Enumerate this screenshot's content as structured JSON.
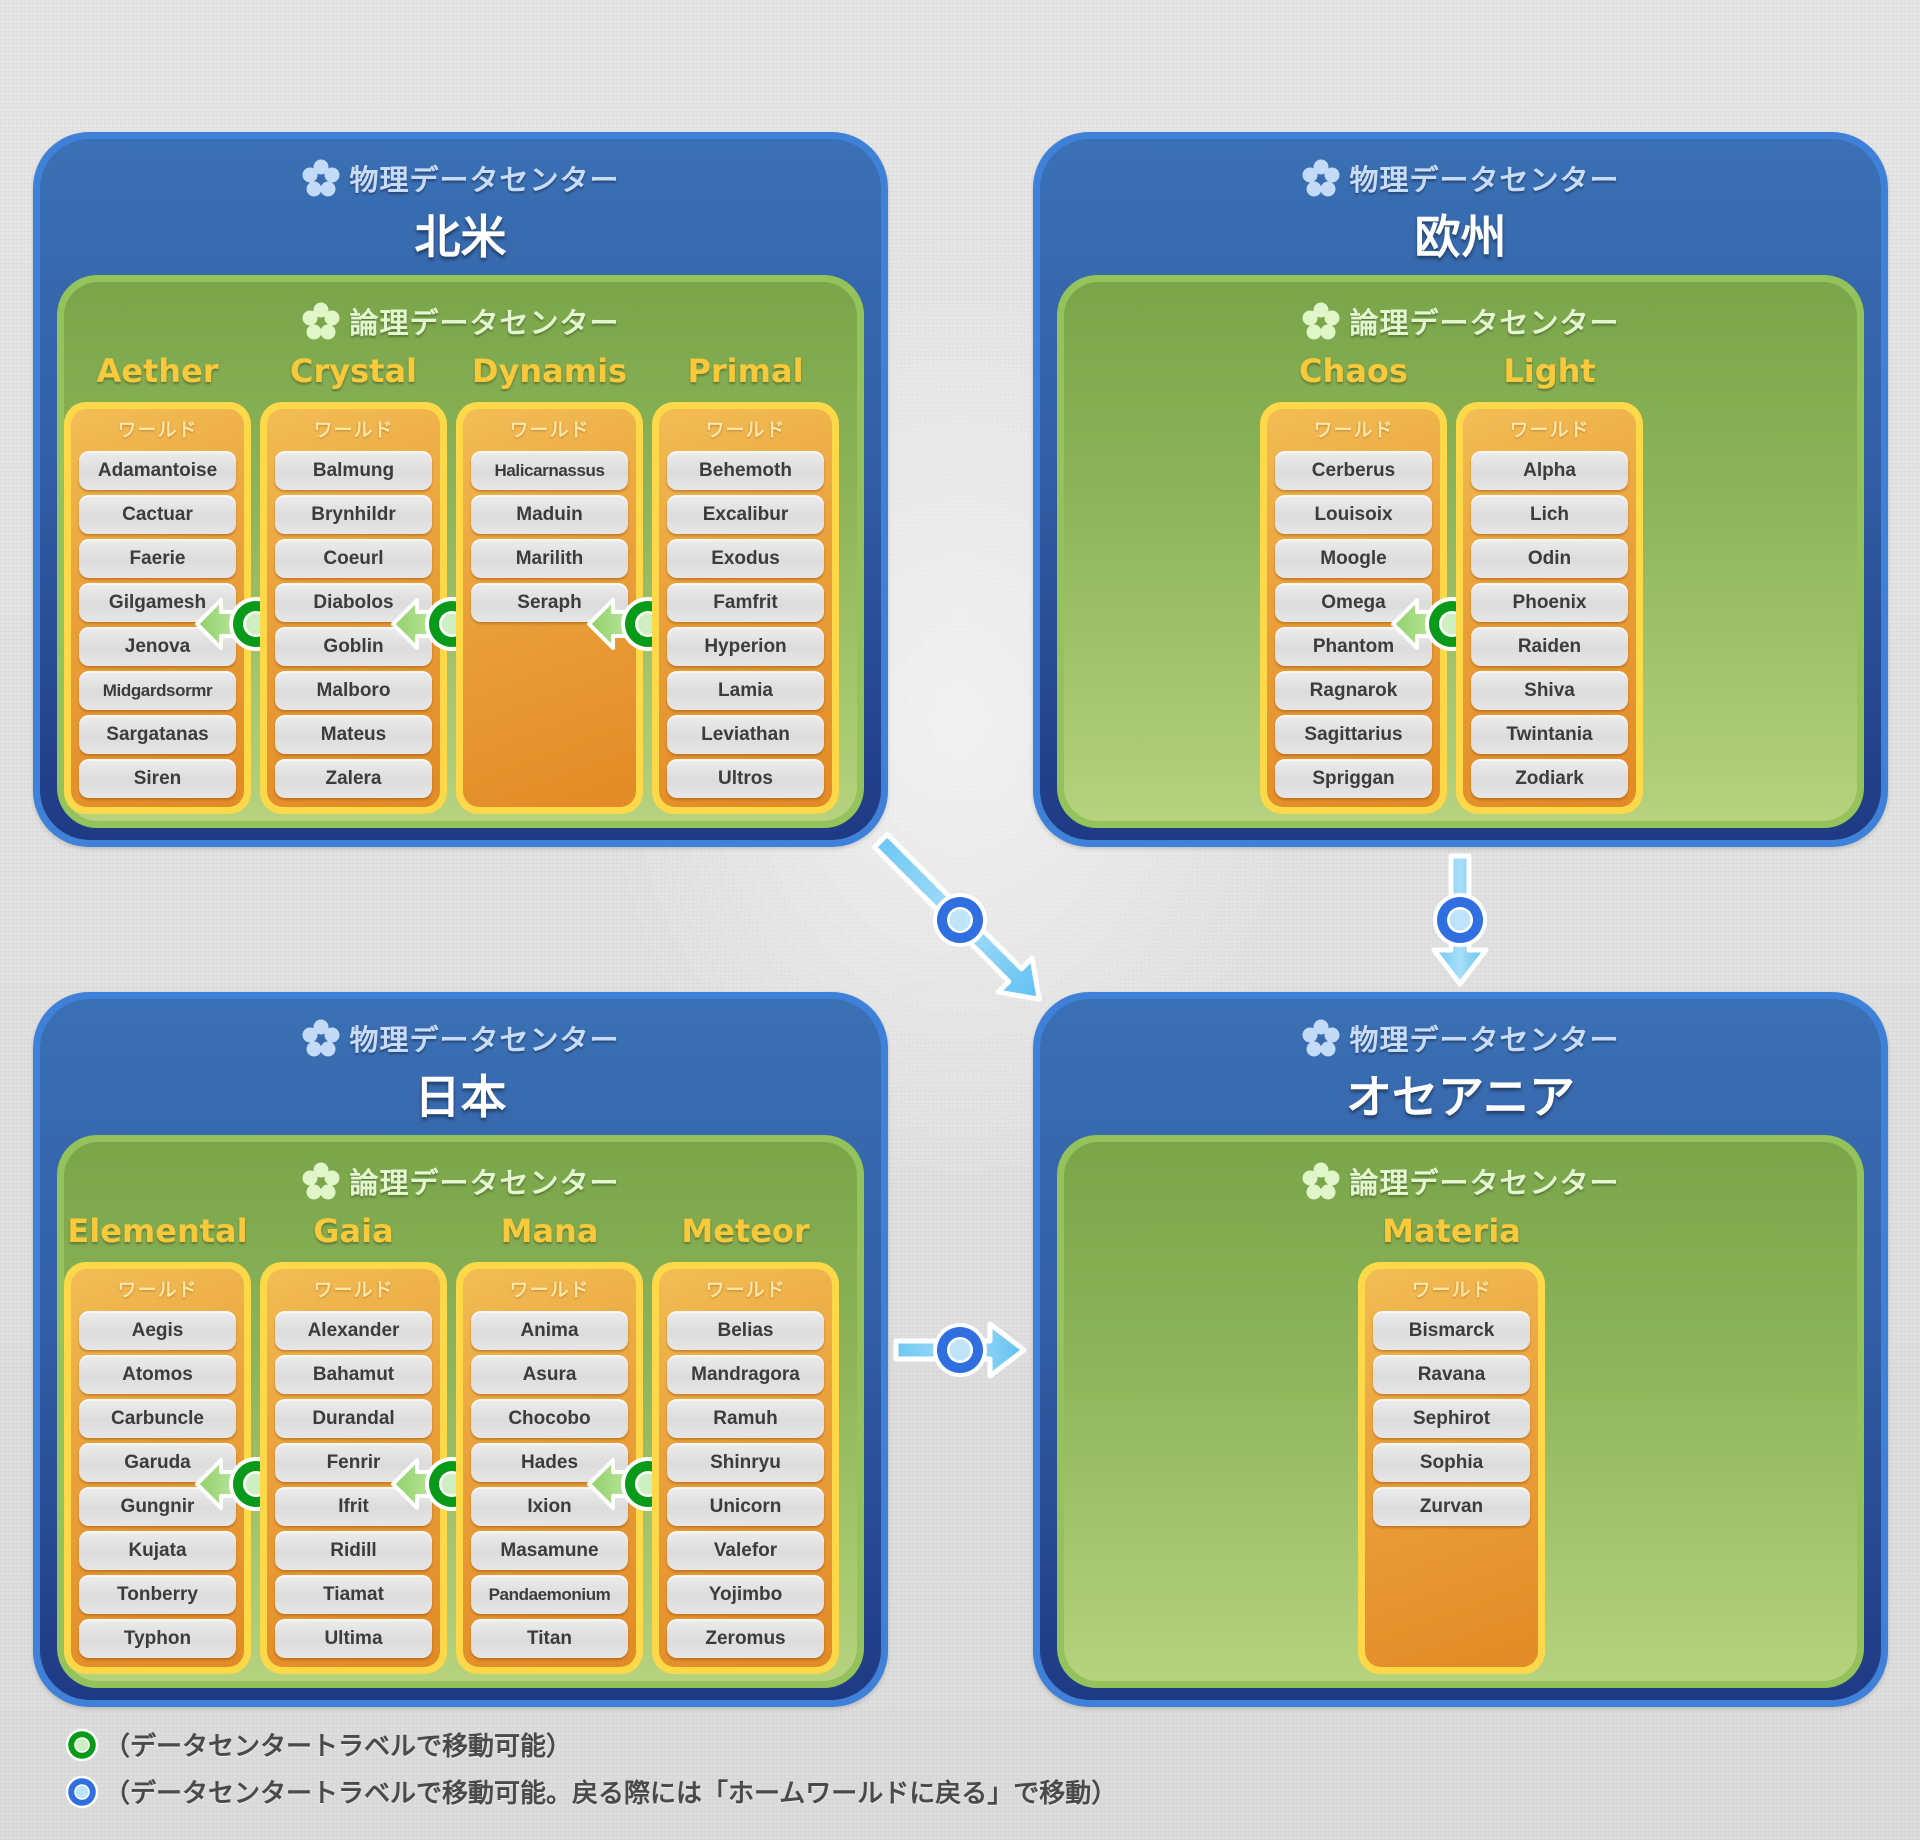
{
  "labels": {
    "physical_dc": "物理データセンター",
    "logical_dc": "論理データセンター",
    "world_header": "ワールド"
  },
  "colors": {
    "physical_border": "#3f80d8",
    "physical_fill": "#335fa6",
    "logical_border": "#93c35a",
    "logical_fill": "#8db45a",
    "dc_name": "#f8c93b",
    "column_border": "#fdd94a",
    "column_fill": "#eba23c",
    "green_marker": "#0a9a1a",
    "blue_marker": "#2f6fe0"
  },
  "regions": [
    {
      "id": "na",
      "title": "北米",
      "data_centers": [
        {
          "name": "Aether",
          "worlds": [
            "Adamantoise",
            "Cactuar",
            "Faerie",
            "Gilgamesh",
            "Jenova",
            "Midgardsormr",
            "Sargatanas",
            "Siren"
          ]
        },
        {
          "name": "Crystal",
          "worlds": [
            "Balmung",
            "Brynhildr",
            "Coeurl",
            "Diabolos",
            "Goblin",
            "Malboro",
            "Mateus",
            "Zalera"
          ]
        },
        {
          "name": "Dynamis",
          "worlds": [
            "Halicarnassus",
            "Maduin",
            "Marilith",
            "Seraph"
          ]
        },
        {
          "name": "Primal",
          "worlds": [
            "Behemoth",
            "Excalibur",
            "Exodus",
            "Famfrit",
            "Hyperion",
            "Lamia",
            "Leviathan",
            "Ultros"
          ]
        }
      ]
    },
    {
      "id": "eu",
      "title": "欧州",
      "data_centers": [
        {
          "name": "Chaos",
          "worlds": [
            "Cerberus",
            "Louisoix",
            "Moogle",
            "Omega",
            "Phantom",
            "Ragnarok",
            "Sagittarius",
            "Spriggan"
          ]
        },
        {
          "name": "Light",
          "worlds": [
            "Alpha",
            "Lich",
            "Odin",
            "Phoenix",
            "Raiden",
            "Shiva",
            "Twintania",
            "Zodiark"
          ]
        }
      ]
    },
    {
      "id": "jp",
      "title": "日本",
      "data_centers": [
        {
          "name": "Elemental",
          "worlds": [
            "Aegis",
            "Atomos",
            "Carbuncle",
            "Garuda",
            "Gungnir",
            "Kujata",
            "Tonberry",
            "Typhon"
          ]
        },
        {
          "name": "Gaia",
          "worlds": [
            "Alexander",
            "Bahamut",
            "Durandal",
            "Fenrir",
            "Ifrit",
            "Ridill",
            "Tiamat",
            "Ultima"
          ]
        },
        {
          "name": "Mana",
          "worlds": [
            "Anima",
            "Asura",
            "Chocobo",
            "Hades",
            "Ixion",
            "Masamune",
            "Pandaemonium",
            "Titan"
          ]
        },
        {
          "name": "Meteor",
          "worlds": [
            "Belias",
            "Mandragora",
            "Ramuh",
            "Shinryu",
            "Unicorn",
            "Valefor",
            "Yojimbo",
            "Zeromus"
          ]
        }
      ]
    },
    {
      "id": "oc",
      "title": "オセアニア",
      "data_centers": [
        {
          "name": "Materia",
          "worlds": [
            "Bismarck",
            "Ravana",
            "Sephirot",
            "Sophia",
            "Zurvan"
          ]
        }
      ]
    }
  ],
  "connections": {
    "green_two_way": [
      "Aether-Crystal",
      "Crystal-Dynamis",
      "Dynamis-Primal",
      "Chaos-Light",
      "Elemental-Gaia",
      "Gaia-Mana",
      "Mana-Meteor"
    ],
    "blue_one_way": [
      "北米→オセアニア",
      "欧州→オセアニア",
      "日本→オセアニア"
    ]
  },
  "legend": [
    {
      "marker": "green-ring-icon",
      "text": "（データセンタートラベルで移動可能）"
    },
    {
      "marker": "blue-ring-icon",
      "text": "（データセンタートラベルで移動可能。戻る際には「ホームワールドに戻る」で移動）"
    }
  ]
}
